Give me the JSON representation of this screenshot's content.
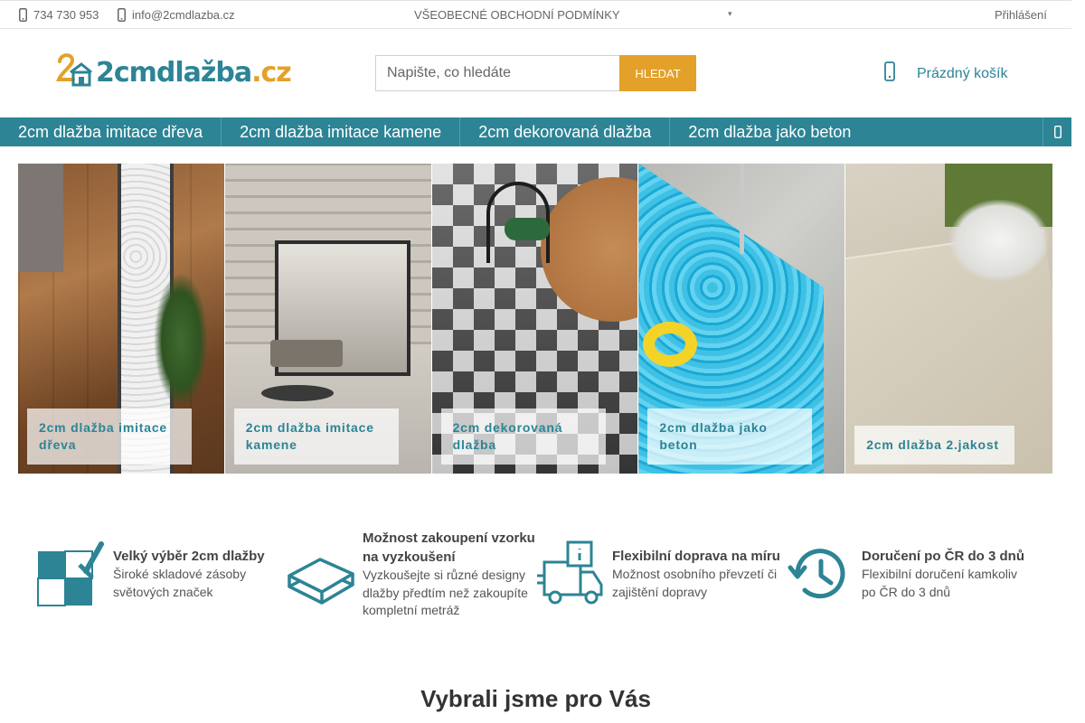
{
  "topbar": {
    "phone": "734 730 953",
    "email": "info@2cmdlazba.cz",
    "terms": "VŠEOBECNÉ OBCHODNÍ PODMÍNKY",
    "login": "Přihlášení"
  },
  "header": {
    "logo_text": "2cmdlažba",
    "logo_tld": ".cz",
    "search_placeholder": "Napište, co hledáte",
    "search_button": "HLEDAT",
    "cart_label": "Prázdný košík"
  },
  "nav": {
    "items": [
      {
        "label": "2cm dlažba imitace dřeva"
      },
      {
        "label": "2cm dlažba imitace kamene"
      },
      {
        "label": "2cm dekorovaná dlažba"
      },
      {
        "label": "2cm dlažba jako beton"
      }
    ]
  },
  "categories": [
    {
      "label": "2cm dlažba imitace dřeva"
    },
    {
      "label": "2cm dlažba imitace kamene"
    },
    {
      "label": "2cm dekorovaná dlažba"
    },
    {
      "label": "2cm dlažba jako beton"
    },
    {
      "label": "2cm dlažba 2.jakost"
    }
  ],
  "features": [
    {
      "title": "Velký výběr 2cm dlažby",
      "text": "Široké skladové zásoby světových značek",
      "icon": "tiles-icon"
    },
    {
      "title": "Možnost zakoupení vzorku na vyzkoušení",
      "text": "Vyzkoušejte si různé designy dlažby předtím než zakoupíte kompletní metráž",
      "icon": "sample-tiles-icon"
    },
    {
      "title": "Flexibilní doprava na míru",
      "text": "Možnost osobního převzetí či zajištění dopravy",
      "icon": "delivery-truck-icon"
    },
    {
      "title": "Doručení po ČR do 3 dnů",
      "text": "Flexibilní doručení kamkoliv po ČR do 3 dnů",
      "icon": "clock-history-icon"
    }
  ],
  "recommended_title": "Vybrali jsme pro Vás",
  "colors": {
    "accent": "#2c8495",
    "accent_orange": "#e3a12a"
  }
}
